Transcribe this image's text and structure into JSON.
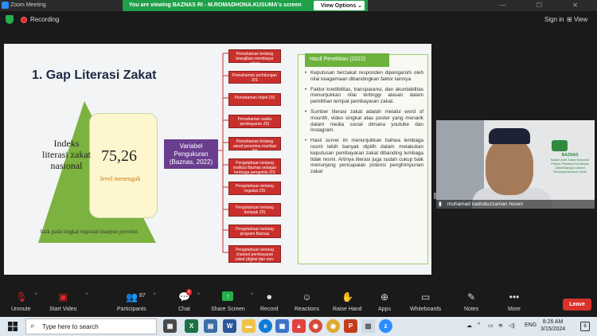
{
  "window": {
    "app_title": "Zoom Meeting",
    "banner_text": "You are viewing BAZNAS RI - M.ROMADHONA.KUSUMA's screen",
    "view_options_label": "View Options"
  },
  "topbar": {
    "recording_label": "Recording",
    "sign_in_label": "Sign in",
    "view_label": "View"
  },
  "slide": {
    "title": "1. Gap Literasi Zakat",
    "triangle_label": "Indeks literasi zakat nasional",
    "index_value": "75,26",
    "level_label": "level menengah",
    "base_label": "baik pada tingkat regional maupun provinsi",
    "variable_box": "Variabel Pengukuran (Baznas, 2022)",
    "measures": [
      "Pemahaman tentang kewajiban membayar zakat",
      "Pemahaman perhitungan ZIS",
      "Pemahaman objek ZIS",
      "Pemahaman waktu pembayaran ZIS",
      "Pemahaman tentang asnaf penerima manfaat ZIS",
      "Pengetahuan tentang institusi Baznas sebagai lembaga pengelola ZIS",
      "Pengetahuan tentang regulasi ZIS",
      "Pengetahuan tentang dampak ZIS",
      "Pengetahuan tentang program Baznas",
      "Pengetahuan tentang channel pembayaran zakat (digital dan non-digital)"
    ],
    "hasil_title": "Hasil Penelitian (2022)",
    "hasil_points": [
      "Keputusan berzakat responden dipengaruhi oleh nilai keagamaan dibandingkan faktor lainnya",
      "Faktor kredibilitas, transparansi, dan akuntabilitas menunjukkan nilai tertinggi alasan dalam pemilihan tempat pembayaran zakat.",
      "Sumber literasi zakat adalah melalui word of mounth, video singkat atau poster yang menarik dalam media social dimana youtube dan Instagram.",
      "Hasil survei ini menunjukkan bahwa lembaga resmi lebih banyak dipilih dalam melakukan keputusan pembayaran zakat dibanding lembaga tidak resmi. Artinya literasi juga sudah cukup baik menunjang pencapaian potensi penghimpunan zakat"
    ]
  },
  "video": {
    "participant_name": "muhamad nadratuzzaman hosen",
    "logo_title": "BAZNAS",
    "logo_subtitle": "Badan Amil Zakat Nasional",
    "logo_caption": "Pilihan Pertama Pembayar Zakat Bangsa Utama Menyejahterakan Umat"
  },
  "toolbar": {
    "unmute": "Unmute",
    "start_video": "Start Video",
    "participants": "Participants",
    "participants_count": "87",
    "chat": "Chat",
    "chat_badge": "4",
    "share_screen": "Share Screen",
    "record": "Record",
    "reactions": "Reactions",
    "raise_hand": "Raise Hand",
    "apps": "Apps",
    "whiteboards": "Whiteboards",
    "notes": "Notes",
    "more": "More",
    "leave": "Leave"
  },
  "taskbar": {
    "search_placeholder": "Type here to search",
    "lang": "ENG",
    "time": "8:26 AM",
    "date": "3/15/2024",
    "notif_count": "6"
  },
  "colors": {
    "zoom_green": "#1fa049",
    "leave_red": "#d9322b",
    "slide_green": "#6cb23c",
    "measure_red": "#c9302c",
    "variable_purple": "#6a3d8f"
  }
}
